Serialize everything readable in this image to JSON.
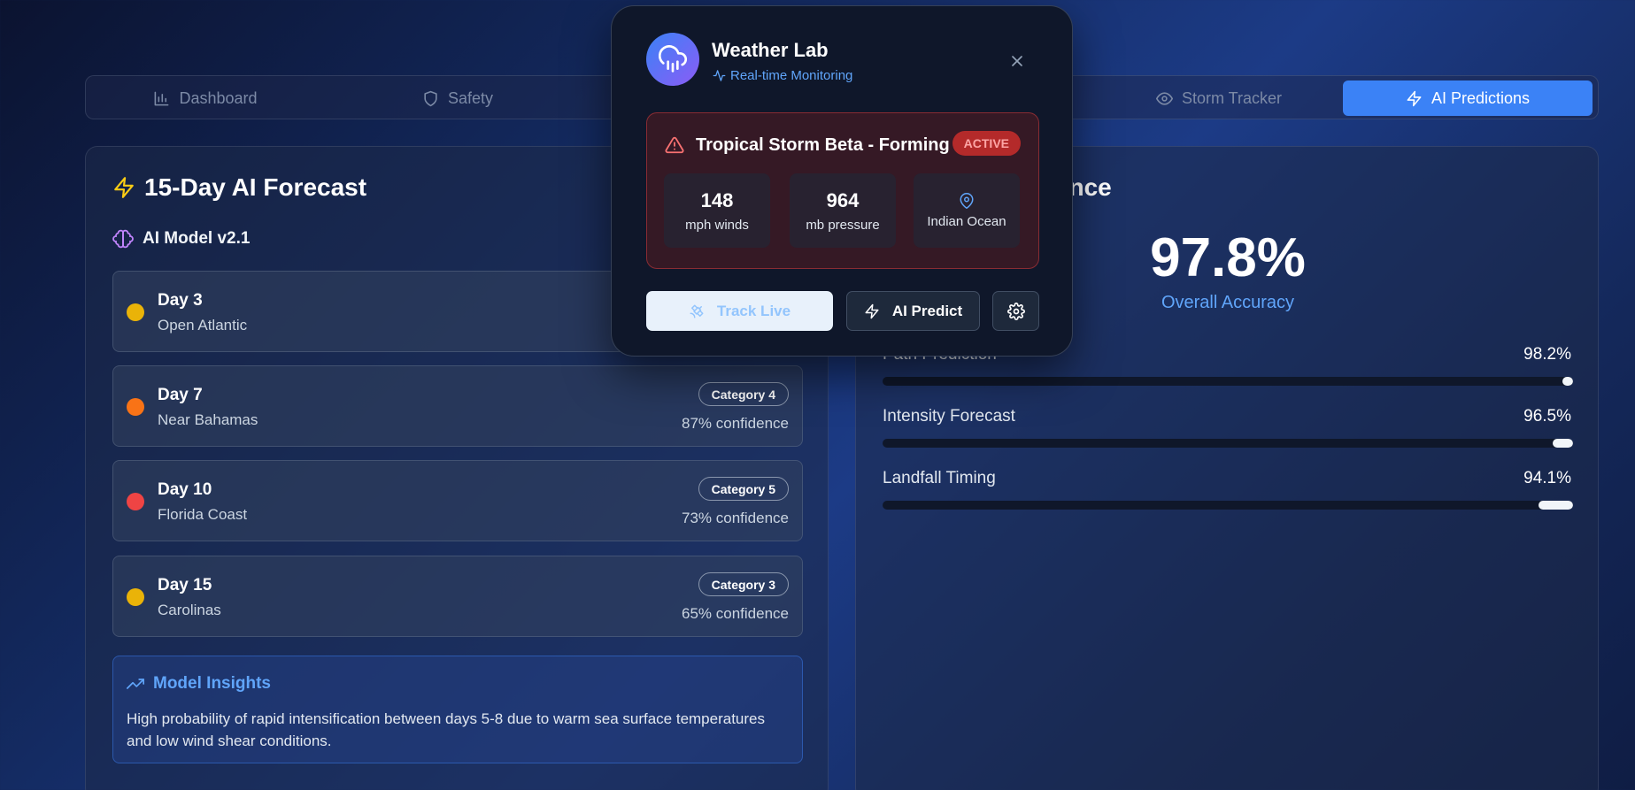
{
  "nav": {
    "items": [
      {
        "label": "Dashboard",
        "icon": "bar-chart-icon"
      },
      {
        "label": "Safety",
        "icon": "shield-icon"
      },
      {
        "label": "Storm Tracker",
        "icon": "eye-icon"
      },
      {
        "label": "AI Predictions",
        "icon": "lightning-icon",
        "active": true
      }
    ]
  },
  "forecast": {
    "title": "15-Day AI Forecast",
    "model": "AI Model v2.1",
    "days": [
      {
        "day": "Day 3",
        "location": "Open Atlantic",
        "category": "",
        "confidence": "",
        "color": "#eab308"
      },
      {
        "day": "Day 7",
        "location": "Near Bahamas",
        "category": "Category 4",
        "confidence": "87% confidence",
        "color": "#f97316"
      },
      {
        "day": "Day 10",
        "location": "Florida Coast",
        "category": "Category 5",
        "confidence": "73% confidence",
        "color": "#ef4444"
      },
      {
        "day": "Day 15",
        "location": "Carolinas",
        "category": "Category 3",
        "confidence": "65% confidence",
        "color": "#eab308"
      }
    ],
    "insights": {
      "title": "Model Insights",
      "text": "High probability of rapid intensification between days 5-8 due to warm sea surface temperatures and low wind shear conditions."
    }
  },
  "performance": {
    "title_visible": "mance",
    "overall_value": "97.8%",
    "overall_label": "Overall Accuracy",
    "metrics": [
      {
        "label": "Path Prediction",
        "value": "98.2%",
        "fraction": 0.982
      },
      {
        "label": "Intensity Forecast",
        "value": "96.5%",
        "fraction": 0.965
      },
      {
        "label": "Landfall Timing",
        "value": "94.1%",
        "fraction": 0.941
      }
    ]
  },
  "popup": {
    "title": "Weather Lab",
    "subtitle": "Real-time Monitoring",
    "alert": {
      "title": "Tropical Storm Beta - Forming",
      "badge": "ACTIVE",
      "stats": [
        {
          "value": "148",
          "label": "mph winds"
        },
        {
          "value": "964",
          "label": "mb pressure"
        },
        {
          "value": "",
          "label": "Indian Ocean"
        }
      ]
    },
    "buttons": {
      "track": "Track Live",
      "predict": "AI Predict"
    }
  },
  "colors": {
    "accent": "#3b82f6",
    "alert": "#ef4444",
    "insight": "#60a5fa"
  }
}
